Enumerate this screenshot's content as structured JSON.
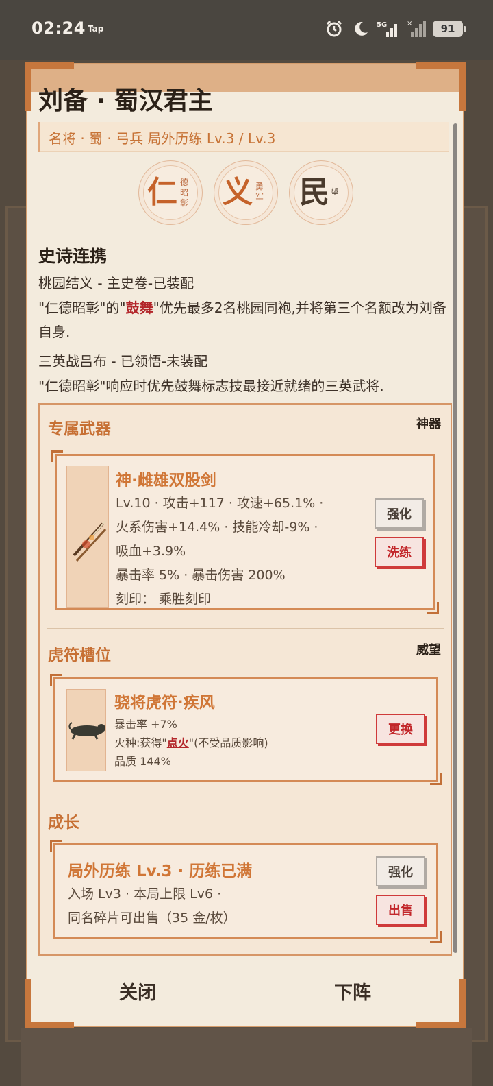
{
  "status_bar": {
    "time": "02:24",
    "tap_label": "Tap",
    "battery": "91",
    "icons": [
      "alarm-icon",
      "moon-icon",
      "signal-5g-icon",
      "signal-icon"
    ]
  },
  "modal": {
    "title": "刘备 · 蜀汉君主",
    "subtitle": "名将 · 蜀 · 弓兵  局外历练 Lv.3 / Lv.3",
    "badges": [
      {
        "main": "仁",
        "sub": "德昭彰"
      },
      {
        "main": "义",
        "sub": "勇军"
      },
      {
        "main": "民",
        "sub": "望"
      }
    ],
    "epic_heading": "史诗连携",
    "epics": [
      {
        "title": "桃园结义 - 主史卷-已装配",
        "desc_prefix": "\"仁德昭彰\"的\"",
        "desc_highlight": "鼓舞",
        "desc_suffix": "\"优先最多2名桃园同袍,并将第三个名额改为刘备自身."
      },
      {
        "title": "三英战吕布 - 已领悟-未装配",
        "desc": "\"仁德昭彰\"响应时优先鼓舞标志技最接近就绪的三英武将."
      }
    ],
    "weapon_section": {
      "heading": "专属武器",
      "link": "神器",
      "name": "神·雌雄双股剑",
      "stats": [
        "Lv.10 · 攻击+117 · 攻速+65.1% ·",
        "火系伤害+14.4% · 技能冷却-9% ·",
        "吸血+3.9%",
        "暴击率 5% · 暴击伤害 200%",
        "刻印： 乘胜刻印"
      ],
      "btn_upgrade": "强化",
      "btn_reroll": "洗练"
    },
    "tiger_section": {
      "heading": "虎符槽位",
      "link": "威望",
      "name": "骁将虎符·疾风",
      "stat1": "暴击率 +7%",
      "stat2_prefix": "火种:获得\"",
      "stat2_highlight": "点火",
      "stat2_suffix": "\"(不受品质影响)",
      "stat3": "品质 144%",
      "btn_replace": "更换"
    },
    "growth_section": {
      "heading": "成长",
      "name": "局外历练 Lv.3 · 历练已满",
      "line1": "入场 Lv3 · 本局上限 Lv6 ·",
      "line2": "同名碎片可出售（35 金/枚）",
      "btn_upgrade": "强化",
      "btn_sell": "出售"
    },
    "footer": {
      "close": "关闭",
      "unassign": "下阵"
    }
  },
  "colors": {
    "accent": "#c77336",
    "highlight_red": "#b3262a",
    "modal_bg": "#f3ebdd",
    "frame": "#c7773d"
  }
}
